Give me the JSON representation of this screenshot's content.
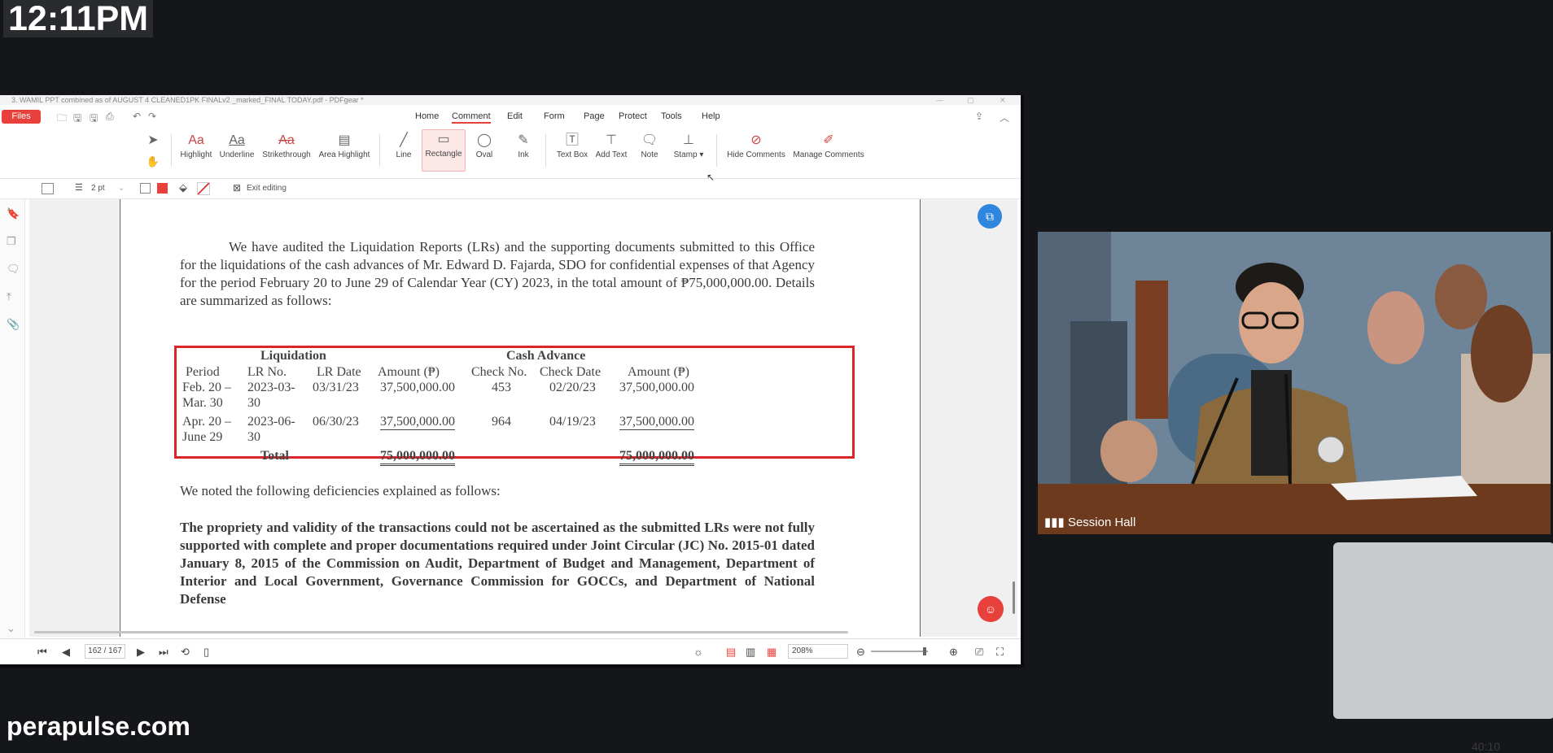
{
  "clock": "12:11PM",
  "brand": "perapulse.com",
  "timestamp": "40:10",
  "window": {
    "title": "3. WAMIL PPT combined as of AUGUST 4 CLEANED1PK FINALv2 _marked_FINAL TODAY.pdf - PDFgear *",
    "files_label": "Files",
    "menus": [
      "Home",
      "Comment",
      "Edit",
      "Form",
      "Page",
      "Protect",
      "Tools",
      "Help"
    ],
    "active_menu": "Comment",
    "tools": {
      "highlight": "Highlight",
      "underline": "Underline",
      "strikethrough": "Strikethrough",
      "area_highlight": "Area Highlight",
      "line": "Line",
      "rectangle": "Rectangle",
      "oval": "Oval",
      "ink": "Ink",
      "text_box": "Text Box",
      "add_text": "Add Text",
      "note": "Note",
      "stamp": "Stamp",
      "hide_comments": "Hide Comments",
      "manage_comments": "Manage Comments"
    },
    "props": {
      "stroke_width": "2 pt",
      "exit_editing": "Exit editing",
      "stroke_color": "#e8403b"
    },
    "statusbar": {
      "page_indicator": "162 / 167",
      "zoom": "208%"
    }
  },
  "document": {
    "para1": "We have audited the Liquidation Reports (LRs) and the supporting documents submitted to this Office for the liquidations of the cash advances of Mr. Edward D. Fajarda, SDO for confidential expenses of that Agency for the period February 20 to June 29 of Calendar Year (CY) 2023, in the total amount of ₱75,000,000.00. Details are summarized as follows:",
    "table": {
      "group_liquidation": "Liquidation",
      "group_cash_advance": "Cash Advance",
      "headers": [
        "Period",
        "LR No.",
        "LR Date",
        "Amount (₱)",
        "Check No.",
        "Check Date",
        "Amount (₱)"
      ],
      "rows": [
        [
          "Feb. 20 – Mar. 30",
          "2023-03-30",
          "03/31/23",
          "37,500,000.00",
          "453",
          "02/20/23",
          "37,500,000.00"
        ],
        [
          "Apr. 20 – June 29",
          "2023-06-30",
          "06/30/23",
          "37,500,000.00",
          "964",
          "04/19/23",
          "37,500,000.00"
        ]
      ],
      "total_label": "Total",
      "total_liquidation": "75,000,000.00",
      "total_cash_advance": "75,000,000.00"
    },
    "para2": "We noted the following deficiencies explained as follows:",
    "para3": "The propriety and validity of the transactions could not be ascertained as the submitted LRs were not fully supported with complete and proper documentations required under Joint Circular (JC) No. 2015-01 dated January 8, 2015 of the Commission on Audit, Department of Budget and Management, Department of Interior and Local Government, Governance Commission for GOCCs, and Department of National Defense"
  },
  "video": {
    "label": "Session Hall"
  }
}
